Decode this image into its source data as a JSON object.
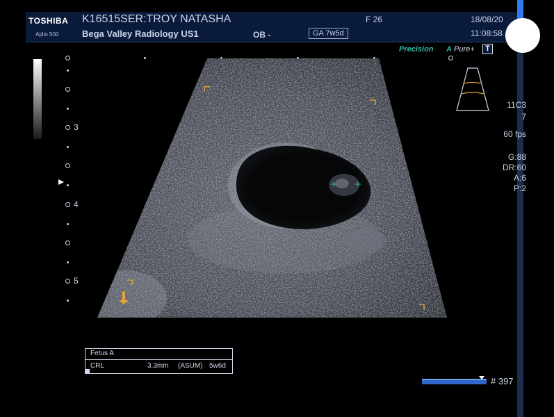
{
  "header": {
    "brand": "TOSHIBA",
    "model": "Aplio 500",
    "patient": "K16515SER:TROY NATASHA",
    "facility": "Bega Valley Radiology US1",
    "mode": "OB -",
    "ga": "GA 7w5d",
    "sex_age": "F  26",
    "date": "18/08/20",
    "time": "11:08:58"
  },
  "toolbar": {
    "precision": "Precision",
    "apure_prefix": "A",
    "apure_text": "Pure+",
    "t_label": "T"
  },
  "depth_scale": {
    "labels": [
      "3",
      "4",
      "5"
    ]
  },
  "params": {
    "probe": "11C3",
    "probe_sub": "7",
    "fps": "60 fps",
    "gain": "G:88",
    "dr": "DR:60",
    "a": "A:6",
    "p": "P:2"
  },
  "measurement": {
    "header": "Fetus A",
    "label": "CRL",
    "value": "3.3mm",
    "method": "(ASUM)",
    "ga": "5w6d"
  },
  "cine": {
    "frame": "# 397"
  },
  "colors": {
    "header_bg": "#0a1a3a",
    "accent_teal": "#34b9a8",
    "caliper_orange": "#e0a23a",
    "cine_blue": "#2f68c9"
  }
}
